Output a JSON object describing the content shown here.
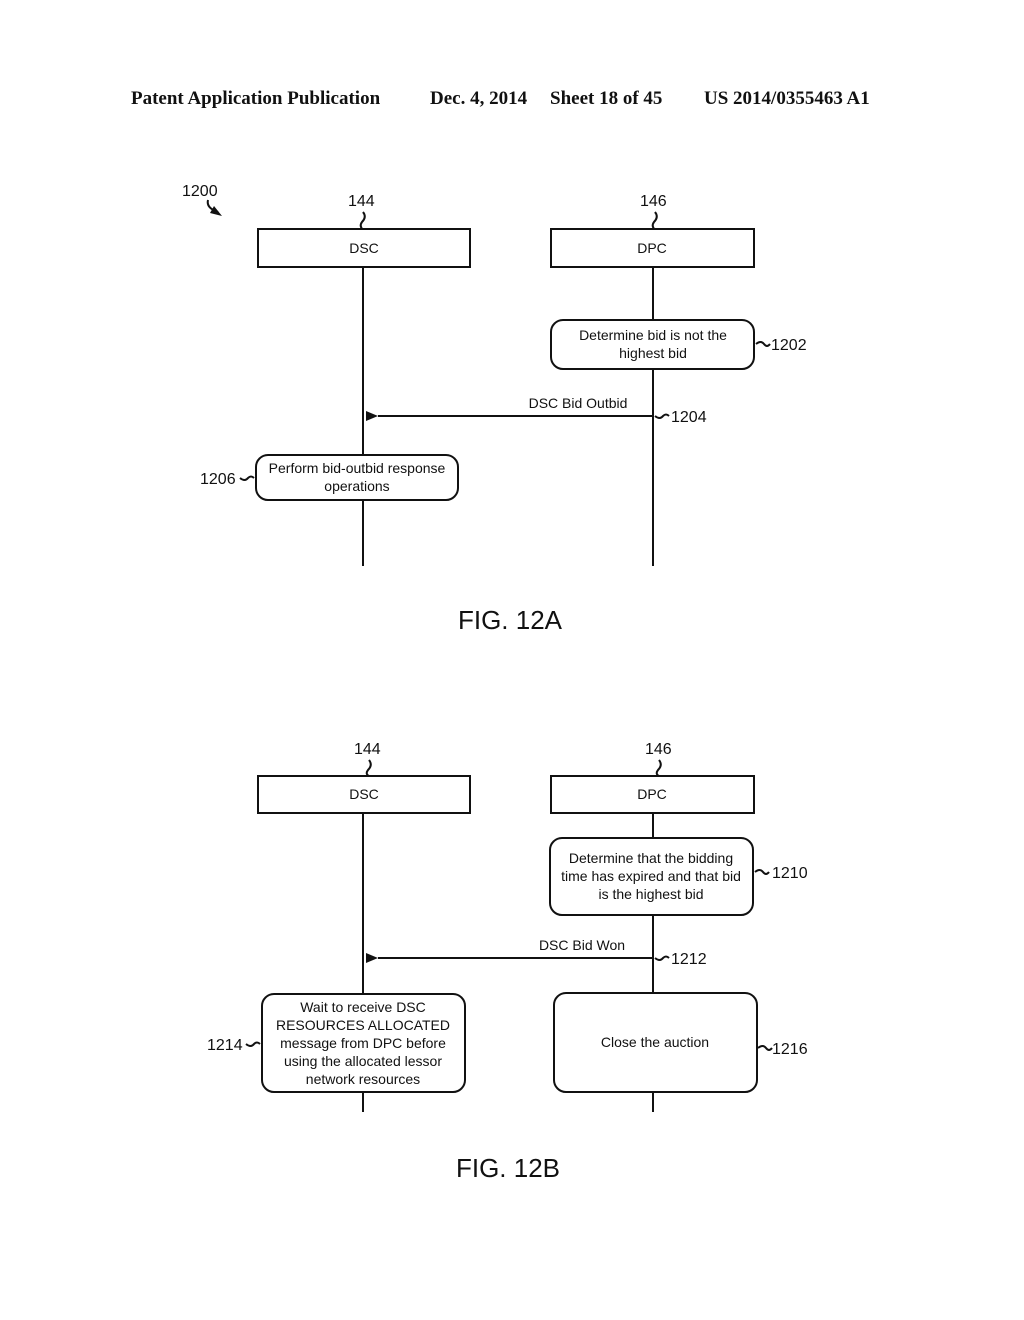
{
  "header": {
    "publication": "Patent Application Publication",
    "date": "Dec. 4, 2014",
    "sheet": "Sheet 18 of 45",
    "number": "US 2014/0355463 A1"
  },
  "fig_a": {
    "ref": "1200",
    "caption": "FIG. 12A",
    "entities": [
      {
        "ref": "144",
        "label": "DSC"
      },
      {
        "ref": "146",
        "label": "DPC"
      }
    ],
    "steps": [
      {
        "ref": "1202",
        "lines": [
          "Determine bid is not the",
          "highest bid"
        ]
      },
      {
        "ref": "1204",
        "message": "DSC Bid Outbid"
      },
      {
        "ref": "1206",
        "lines": [
          "Perform bid-outbid response",
          "operations"
        ]
      }
    ]
  },
  "fig_b": {
    "caption": "FIG. 12B",
    "entities": [
      {
        "ref": "144",
        "label": "DSC"
      },
      {
        "ref": "146",
        "label": "DPC"
      }
    ],
    "steps": [
      {
        "ref": "1210",
        "lines": [
          "Determine that the bidding",
          "time has expired and that bid",
          "is the highest bid"
        ]
      },
      {
        "ref": "1212",
        "message": "DSC Bid Won"
      },
      {
        "ref": "1214",
        "lines": [
          "Wait to receive DSC",
          "RESOURCES ALLOCATED",
          "message from DPC before",
          "using the allocated lessor",
          "network resources"
        ]
      },
      {
        "ref": "1216",
        "lines": [
          "Close the auction"
        ]
      }
    ]
  }
}
